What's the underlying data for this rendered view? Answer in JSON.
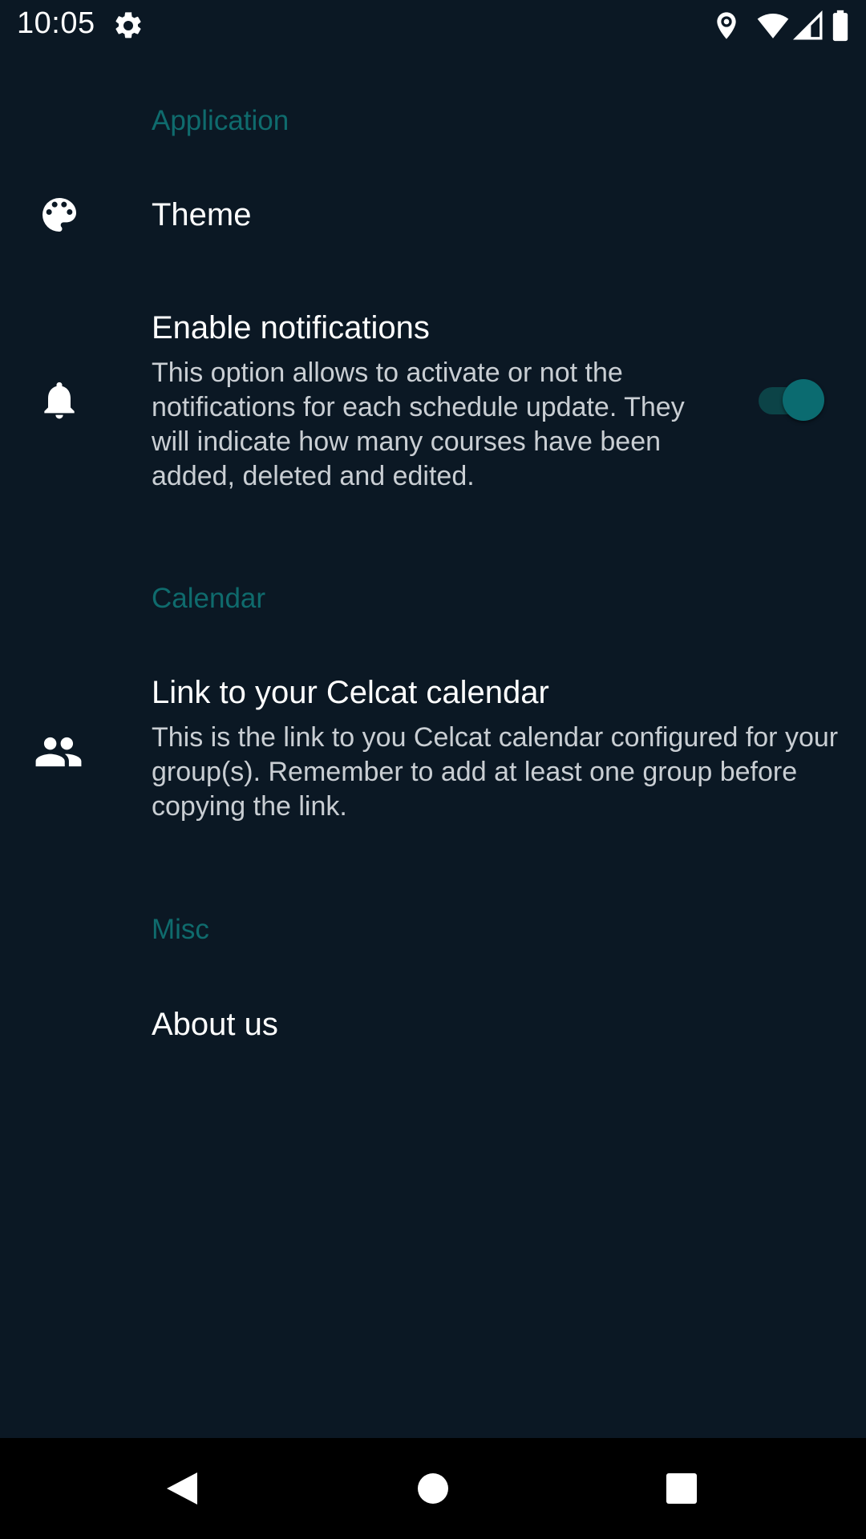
{
  "status_bar": {
    "time": "10:05",
    "icons": [
      "settings-icon",
      "location-icon",
      "wifi-icon",
      "signal-icon",
      "battery-icon"
    ]
  },
  "sections": {
    "application": {
      "header": "Application",
      "theme": {
        "icon": "palette-icon",
        "title": "Theme"
      },
      "notifications": {
        "icon": "bell-icon",
        "title": "Enable notifications",
        "summary": "This option allows to activate or not the notifications for each schedule update. They will indicate how many courses have been added, deleted and edited.",
        "enabled": true
      }
    },
    "calendar": {
      "header": "Calendar",
      "link": {
        "icon": "people-icon",
        "title": "Link to your Celcat calendar",
        "summary": "This is the link to you Celcat calendar configured for your group(s). Remember to add at least one group before copying the link."
      }
    },
    "misc": {
      "header": "Misc",
      "about": {
        "title": "About us"
      }
    }
  },
  "colors": {
    "background": "#0b1824",
    "accent": "#0f6b6d",
    "switch_thumb": "#0b6b70",
    "switch_track": "#0c4347"
  },
  "nav_bar": {
    "icons": [
      "back-icon",
      "home-icon",
      "recents-icon"
    ]
  }
}
